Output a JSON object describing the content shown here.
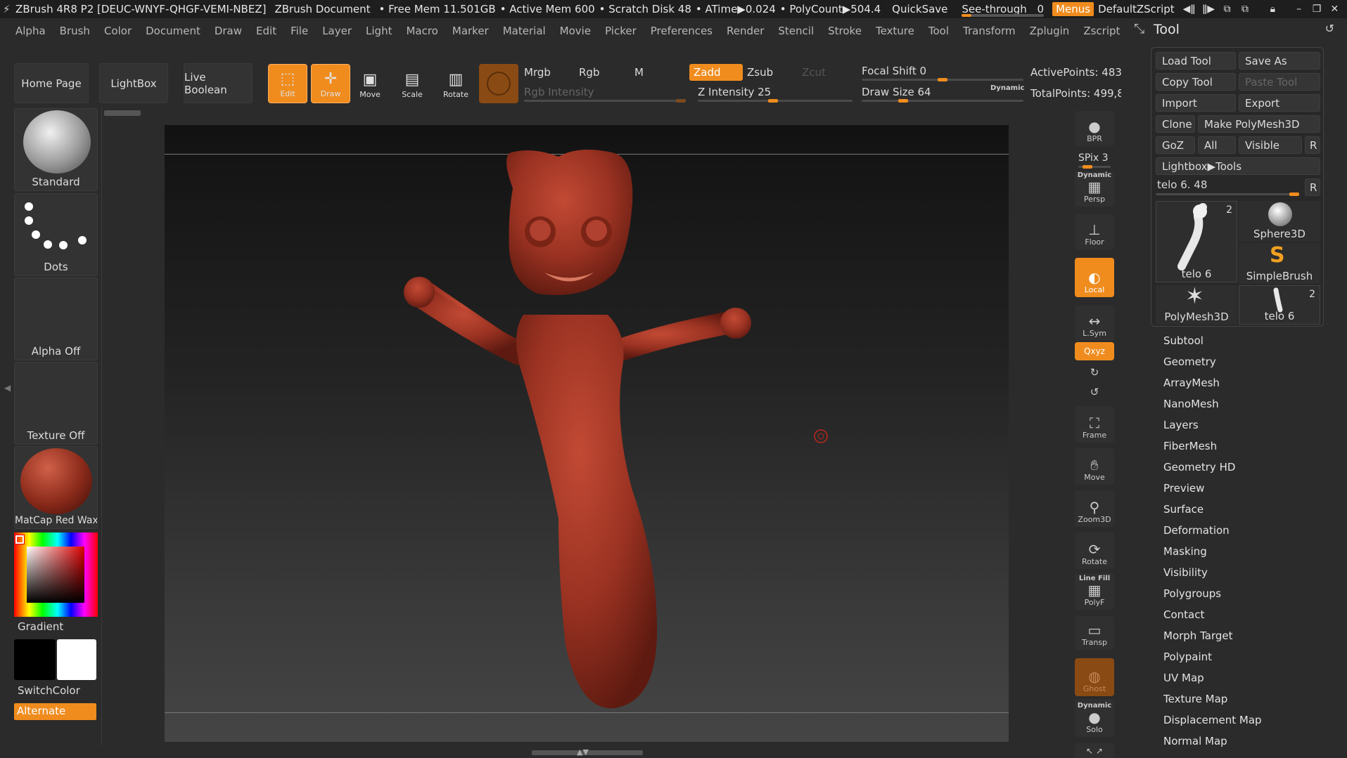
{
  "titlebar": {
    "app": "ZBrush 4R8 P2 [DEUC-WNYF-QHGF-VEMI-NBEZ]",
    "document": "ZBrush Document",
    "free_mem": "• Free Mem 11.501GB",
    "active_mem": "• Active Mem 600",
    "scratch": "• Scratch Disk 48",
    "atime": "• ATime▶0.024",
    "polycount": "• PolyCount▶504.4",
    "quicksave": "QuickSave",
    "see_through": "See-through",
    "see_through_value": "0",
    "menus": "Menus",
    "script": "DefaultZScript"
  },
  "menu": [
    "Alpha",
    "Brush",
    "Color",
    "Document",
    "Draw",
    "Edit",
    "File",
    "Layer",
    "Light",
    "Macro",
    "Marker",
    "Material",
    "Movie",
    "Picker",
    "Preferences",
    "Render",
    "Stencil",
    "Stroke",
    "Texture",
    "Tool",
    "Transform",
    "Zplugin",
    "Zscript"
  ],
  "shelf": {
    "home": "Home Page",
    "lightbox": "LightBox",
    "live_boolean": "Live Boolean",
    "edit": "Edit",
    "draw": "Draw",
    "move": "Move",
    "scale": "Scale",
    "rotate": "Rotate",
    "mrgb": "Mrgb",
    "rgb": "Rgb",
    "m": "M",
    "rgb_intensity": "Rgb Intensity",
    "zadd": "Zadd",
    "zsub": "Zsub",
    "zcut": "Zcut",
    "z_intensity": "Z Intensity 25",
    "focal_shift": "Focal Shift 0",
    "draw_size": "Draw Size 64",
    "dynamic": "Dynamic",
    "active_points": "ActivePoints: 483,",
    "total_points": "TotalPoints: 499,8"
  },
  "left": {
    "brush": "Standard",
    "stroke": "Dots",
    "alpha": "Alpha Off",
    "texture": "Texture Off",
    "material": "MatCap Red Wax",
    "gradient": "Gradient",
    "switchcolor": "SwitchColor",
    "alternate": "Alternate",
    "colors": {
      "material": "#8a2a1a",
      "primary": "#000000",
      "secondary": "#ffffff",
      "model": "#9a3222"
    }
  },
  "righttool": {
    "bpr": "BPR",
    "spix": "SPix 3",
    "persp_top": "Dynamic",
    "persp": "Persp",
    "floor": "Floor",
    "local": "Local",
    "lsym": "L.Sym",
    "xyz": "Qxyz",
    "frame": "Frame",
    "move": "Move",
    "zoom3d": "Zoom3D",
    "rotate": "Rotate",
    "linefill": "Line Fill",
    "polyf": "PolyF",
    "transp": "Transp",
    "ghost": "Ghost",
    "solo_top": "Dynamic",
    "solo": "Solo"
  },
  "tool": {
    "title": "Tool",
    "load": "Load Tool",
    "save": "Save As",
    "copy": "Copy Tool",
    "paste": "Paste Tool",
    "import": "Import",
    "export": "Export",
    "clone": "Clone",
    "make": "Make PolyMesh3D",
    "goz": "GoZ",
    "all": "All",
    "visible": "Visible",
    "r": "R",
    "lightbox_tools": "Lightbox▶Tools",
    "current": "telo 6. 48",
    "thumbs": [
      {
        "name": "telo 6",
        "count": "2"
      },
      {
        "name": "Sphere3D"
      },
      {
        "name": "SimpleBrush"
      },
      {
        "name": "PolyMesh3D"
      },
      {
        "name": "telo 6",
        "count": "2"
      }
    ],
    "subpalettes": [
      "Subtool",
      "Geometry",
      "ArrayMesh",
      "NanoMesh",
      "Layers",
      "FiberMesh",
      "Geometry HD",
      "Preview",
      "Surface",
      "Deformation",
      "Masking",
      "Visibility",
      "Polygroups",
      "Contact",
      "Morph Target",
      "Polypaint",
      "UV Map",
      "Texture Map",
      "Displacement Map",
      "Normal Map"
    ]
  }
}
